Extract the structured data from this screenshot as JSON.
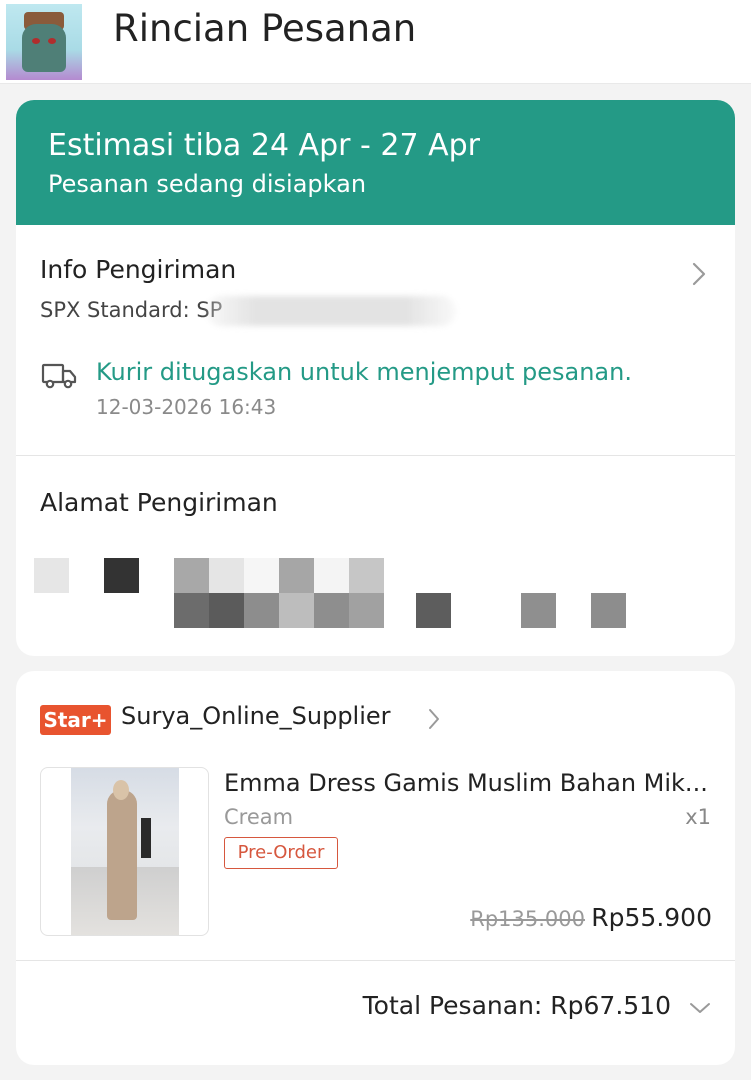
{
  "header": {
    "title": "Rincian Pesanan",
    "avatar_icon": "profile-avatar"
  },
  "status": {
    "eta": "Estimasi tiba 24 Apr - 27 Apr",
    "subtitle": "Pesanan sedang disiapkan",
    "banner_color": "#249a86"
  },
  "shipping": {
    "title": "Info Pengiriman",
    "service": "SPX Standard: SP",
    "courier_message": "Kurir ditugaskan untuk menjemput pesanan.",
    "timestamp": "12-03-2026 16:43",
    "icon": "truck-icon"
  },
  "address": {
    "title": "Alamat Pengiriman"
  },
  "order": {
    "badge": "Star+",
    "badge_color": "#e8542f",
    "shop_name": "Surya_Online_Supplier",
    "product": {
      "name": "Emma Dress Gamis Muslim Bahan Mik...",
      "variant": "Cream",
      "quantity": "x1",
      "tag": "Pre-Order",
      "original_price": "Rp135.000",
      "price": "Rp55.900"
    },
    "total": "Total Pesanan: Rp67.510"
  }
}
